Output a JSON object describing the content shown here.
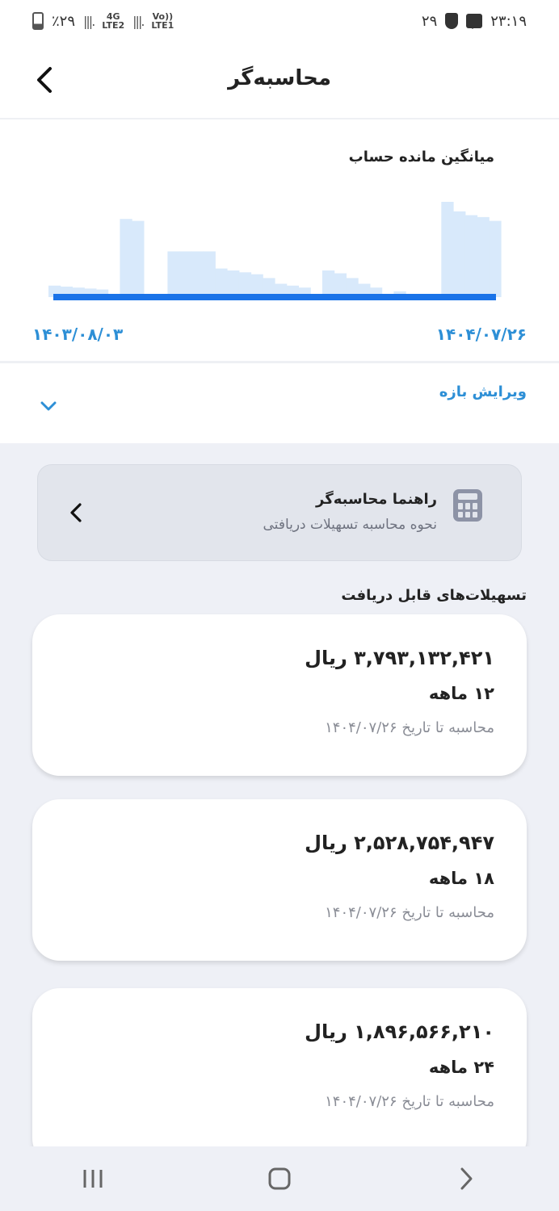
{
  "status_bar": {
    "battery_percent": "٪۲۹",
    "net1_top": "4G",
    "net1_bottom": "LTE2",
    "net2_top": "Vo))",
    "net2_bottom": "LTE1",
    "net0_top": "Vo))",
    "net0_bottom": "LTE2",
    "notification_count": "۲۹",
    "time": "۲۳:۱۹"
  },
  "header": {
    "title": "محاسبه‌گر"
  },
  "chart": {
    "title": "میانگین مانده حساب",
    "date_start": "۱۴۰۳/۰۸/۰۳",
    "date_end": "۱۴۰۴/۰۷/۲۶",
    "area_color": "#d8e9fb",
    "baseline_color": "#1a73e8"
  },
  "chart_data": {
    "type": "area",
    "title": "میانگین مانده حساب",
    "xlabel": "",
    "ylabel": "",
    "x_range": [
      "۱۴۰۳/۰۸/۰۳",
      "۱۴۰۴/۰۷/۲۶"
    ],
    "grid": false,
    "series": [
      {
        "values": [
          0.12,
          0.11,
          0.1,
          0.09,
          0.08,
          0.0,
          0.82,
          0.8,
          0.0,
          0.0,
          0.48,
          0.48,
          0.48,
          0.48,
          0.3,
          0.28,
          0.26,
          0.24,
          0.2,
          0.14,
          0.12,
          0.1,
          0.0,
          0.28,
          0.25,
          0.2,
          0.14,
          0.1,
          0.0,
          0.06,
          0.02,
          0.0,
          0.0,
          1.0,
          0.9,
          0.86,
          0.84,
          0.8
        ]
      }
    ]
  },
  "edit_range": {
    "label": "ویرایش بازه"
  },
  "guide": {
    "title": "راهنما محاسبه‌گر",
    "subtitle": "نحوه محاسبه تسهیلات دریافتی"
  },
  "loans_section": {
    "title": "تسهیلات‌های قابل دریافت",
    "items": [
      {
        "amount": "۳,۷۹۳,۱۳۲,۴۲۱ ریال",
        "term": "۱۲ ماهه",
        "date_note": "محاسبه تا تاریخ ۱۴۰۴/۰۷/۲۶"
      },
      {
        "amount": "۲,۵۲۸,۷۵۴,۹۴۷ ریال",
        "term": "۱۸ ماهه",
        "date_note": "محاسبه تا تاریخ ۱۴۰۴/۰۷/۲۶"
      },
      {
        "amount": "۱,۸۹۶,۵۶۶,۲۱۰ ریال",
        "term": "۲۴ ماهه",
        "date_note": "محاسبه تا تاریخ ۱۴۰۴/۰۷/۲۶"
      }
    ]
  },
  "colors": {
    "accent": "#2d8fd6",
    "background_content": "#eef0f6"
  }
}
